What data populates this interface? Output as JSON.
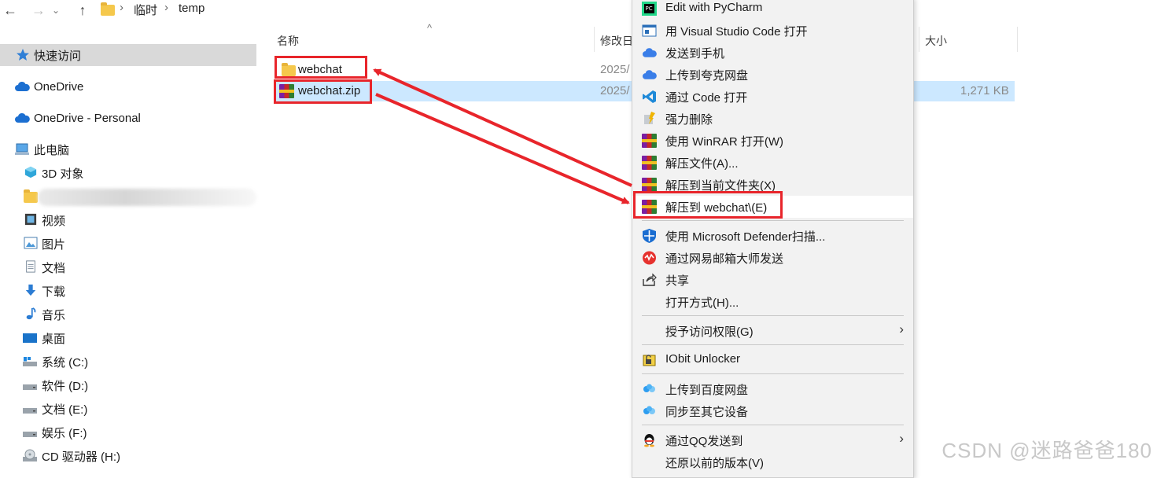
{
  "address_bar": {
    "back_icon": "arrow-left-icon",
    "forward_icon": "arrow-right-icon",
    "recent_icon": "chevron-down-icon",
    "up_icon": "arrow-up-icon",
    "crumbs": [
      "临时",
      "temp"
    ],
    "separator": "›"
  },
  "sidebar": {
    "quick_access": "快速访问",
    "onedrive": "OneDrive",
    "onedrive_personal": "OneDrive - Personal",
    "this_pc": "此电脑",
    "objects_3d": "3D 对象",
    "videos": "视频",
    "pictures": "图片",
    "documents": "文档",
    "downloads": "下载",
    "music": "音乐",
    "desktop": "桌面",
    "drive_c": "系统 (C:)",
    "drive_d": "软件 (D:)",
    "drive_e": "文档 (E:)",
    "drive_f": "娱乐 (F:)",
    "drive_h": "CD 驱动器 (H:)"
  },
  "file_list": {
    "columns": {
      "name": "名称",
      "modified": "修改日",
      "size": "大小"
    },
    "sort_icon": "sort-ascending-icon",
    "rows": [
      {
        "name": "webchat",
        "modified": "2025/",
        "size": "",
        "type": "folder"
      },
      {
        "name": "webchat.zip",
        "modified": "2025/",
        "size": "1,271 KB",
        "type": "zip"
      }
    ]
  },
  "context_menu": {
    "items": [
      {
        "label": "Edit with PyCharm",
        "icon": "pycharm-icon"
      },
      {
        "label": "用 Visual Studio Code 打开",
        "icon": "vscode-window-icon"
      },
      {
        "label": "发送到手机",
        "icon": "cloud-icon"
      },
      {
        "label": "上传到夸克网盘",
        "icon": "cloud-icon"
      },
      {
        "label": "通过 Code 打开",
        "icon": "vscode-icon"
      },
      {
        "label": "强力删除",
        "icon": "shred-icon"
      },
      {
        "label": "使用 WinRAR 打开(W)",
        "icon": "winrar-icon"
      },
      {
        "label": "解压文件(A)...",
        "icon": "winrar-icon"
      },
      {
        "label": "解压到当前文件夹(X)",
        "icon": "winrar-icon"
      },
      {
        "label": "解压到 webchat\\(E)",
        "icon": "winrar-icon"
      },
      {
        "label": "使用 Microsoft Defender扫描...",
        "icon": "defender-shield-icon"
      },
      {
        "label": "通过网易邮箱大师发送",
        "icon": "netease-mail-icon"
      },
      {
        "label": "共享",
        "icon": "share-icon"
      },
      {
        "label": "打开方式(H)...",
        "icon": ""
      },
      {
        "label": "授予访问权限(G)",
        "icon": ""
      },
      {
        "label": "IObit Unlocker",
        "icon": "lock-icon"
      },
      {
        "label": "上传到百度网盘",
        "icon": "baidu-cloud-icon"
      },
      {
        "label": "同步至其它设备",
        "icon": "baidu-cloud-icon"
      },
      {
        "label": "通过QQ发送到",
        "icon": "qq-penguin-icon"
      },
      {
        "label": "还原以前的版本(V)",
        "icon": ""
      }
    ],
    "submenu_arrow": "›"
  },
  "watermark": "CSDN @迷路爸爸180",
  "colors": {
    "selection": "#cce8ff",
    "annotation_red": "#e8252b",
    "menu_bg": "#f2f2f2",
    "sidebar_selected": "#d9d9d9"
  }
}
